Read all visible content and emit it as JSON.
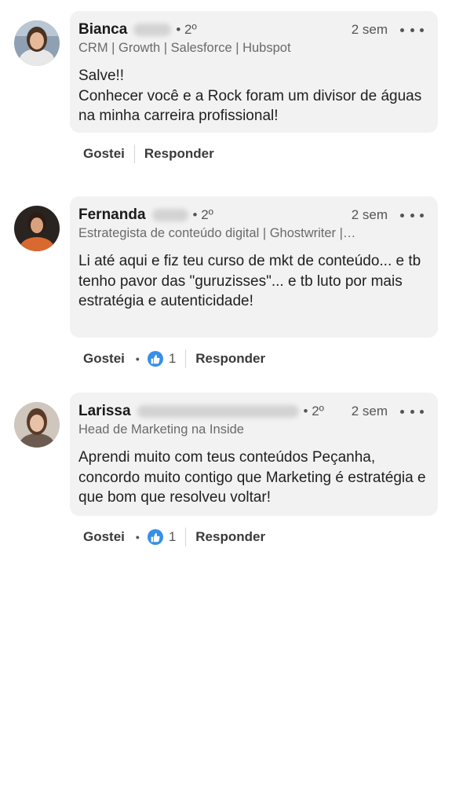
{
  "comments": [
    {
      "name": "Bianca",
      "degree": "• 2º",
      "time": "2 sem",
      "headline": "CRM | Growth | Salesforce | Hubspot",
      "body": "Salve!!\nConhecer você e a Rock foram um divisor de águas na minha carreira profissional!",
      "actions": {
        "like": "Gostei",
        "reply": "Responder"
      }
    },
    {
      "name": "Fernanda",
      "degree": "• 2º",
      "time": "2 sem",
      "headline": "Estrategista de conteúdo digital | Ghostwriter |…",
      "body": "Li até aqui e fiz teu curso de mkt de conteúdo... e tb tenho pavor das \"guruzisses\"... e tb luto por mais estratégia e autenticidade!",
      "actions": {
        "like": "Gostei",
        "dot": "•",
        "like_count": "1",
        "reply": "Responder"
      }
    },
    {
      "name": "Larissa",
      "degree": "• 2º",
      "time": "2 sem",
      "headline": "Head de Marketing na Inside",
      "body": "Aprendi muito com teus conteúdos Peçanha, concordo muito contigo que Marketing é estratégia e que bom que resolveu voltar!",
      "actions": {
        "like": "Gostei",
        "dot": "•",
        "like_count": "1",
        "reply": "Responder"
      }
    }
  ],
  "colors": {
    "bubble": "#f2f2f2",
    "like_blue": "#378fe9",
    "text": "#1f1f1f",
    "muted": "#6a6a6a"
  }
}
